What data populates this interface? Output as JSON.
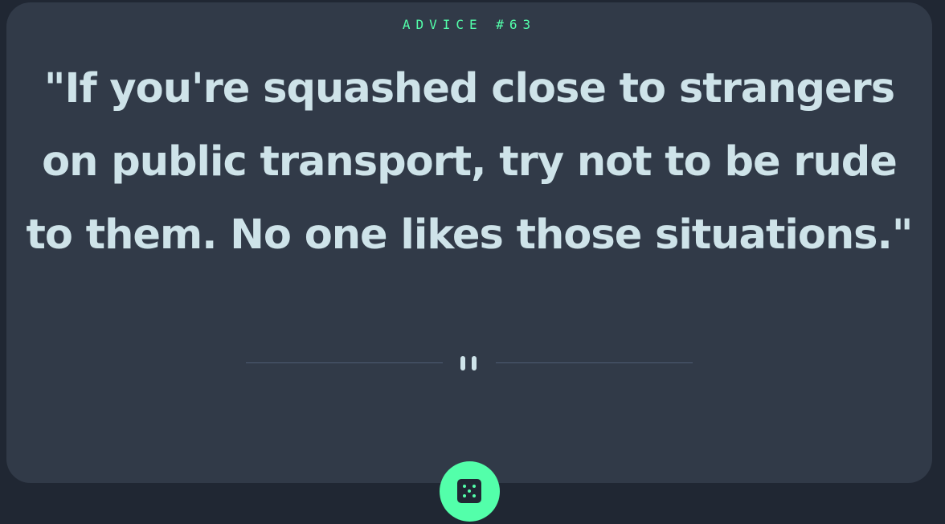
{
  "card": {
    "advice_label": "ADVICE #63",
    "quote": "\"If you're squashed close to strangers on public transport, try not to be rude to them. No one likes those situations.\""
  },
  "divider": {
    "icon": "pause-icon"
  },
  "action": {
    "icon": "dice-icon"
  },
  "colors": {
    "background": "#202733",
    "card": "#313a48",
    "accent": "#53ffaa",
    "text": "#cee3e9",
    "divider": "#4f5d74"
  }
}
